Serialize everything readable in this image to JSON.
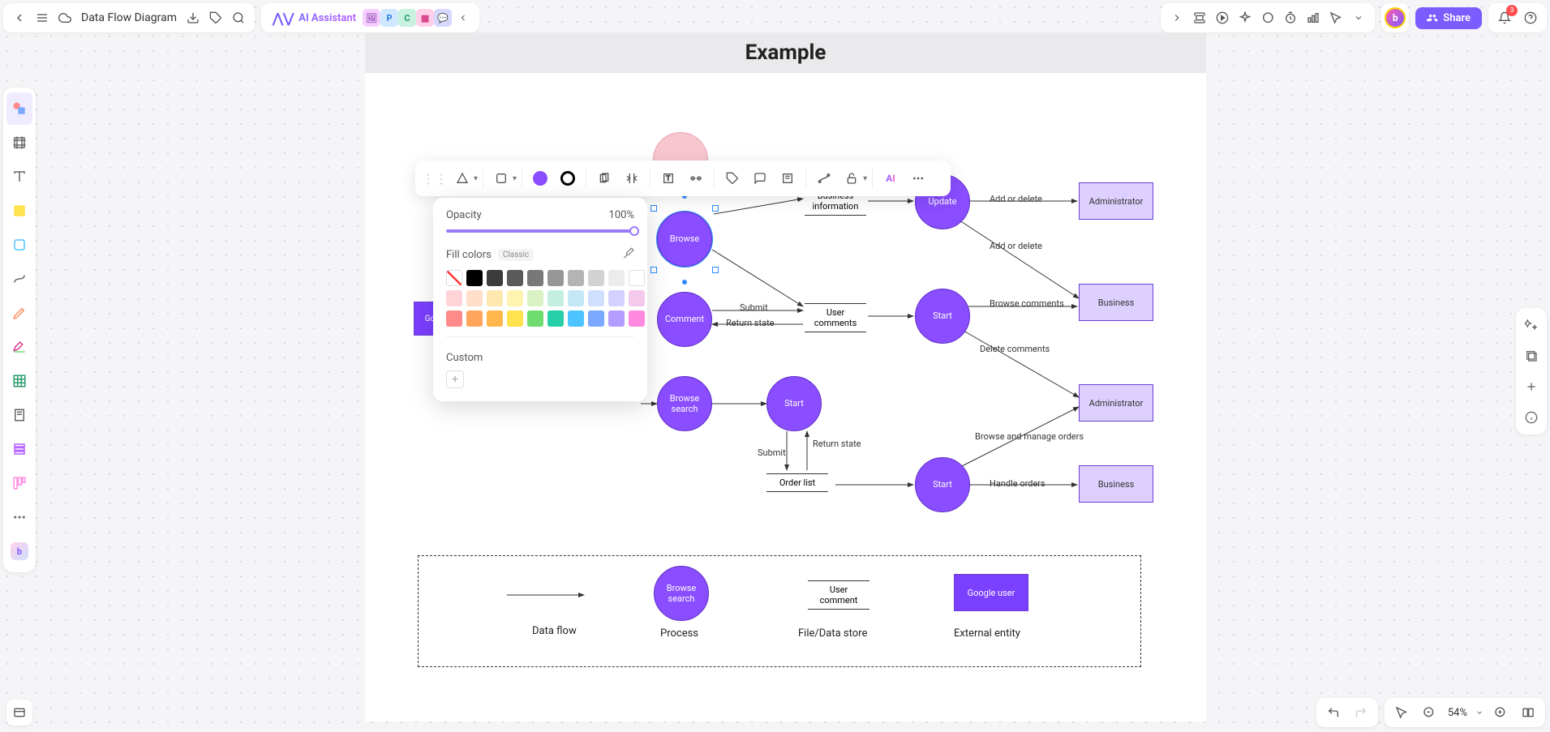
{
  "header": {
    "doc_title": "Data Flow Diagram",
    "ai_label": "AI Assistant",
    "avatar_1": "P",
    "avatar_2": "C",
    "share_label": "Share",
    "notif_count": "3"
  },
  "canvas": {
    "page_title": "Example",
    "zoom_pct": "54%"
  },
  "popover": {
    "opacity_label": "Opacity",
    "opacity_value": "100%",
    "fill_label": "Fill colors",
    "classic_label": "Classic",
    "custom_label": "Custom",
    "colors_row1": [
      "none",
      "#000000",
      "#3c3c3c",
      "#5a5a5a",
      "#787878",
      "#969696",
      "#b4b4b4",
      "#d2d2d2",
      "#ececec",
      "#ffffff"
    ],
    "colors_row2": [
      "#ffd4d8",
      "#ffdfc9",
      "#ffe8b0",
      "#fff3b0",
      "#d9f2c4",
      "#c4efe0",
      "#c4e7f5",
      "#cfe0ff",
      "#d4d0ff",
      "#f5c9ec"
    ],
    "colors_row3": [
      "#ff8a8a",
      "#ffa65c",
      "#ffb74d",
      "#ffe24d",
      "#6edc6e",
      "#26cfa8",
      "#4dc3ff",
      "#7aa9ff",
      "#b39dff",
      "#ff8adf"
    ]
  },
  "diagram": {
    "nodes": {
      "browse_top": "Browse",
      "update": "Update",
      "comment": "Comment",
      "browse_search": "Browse\nsearch",
      "start_mid": "Start",
      "start_search": "Start",
      "start_orders": "Start",
      "go": "Go",
      "admin1": "Administrator",
      "admin2": "Administrator",
      "business1": "Business",
      "business2": "Business"
    },
    "stores": {
      "biz_info": "Business\ninformation",
      "user_comments": "User\ncomments",
      "order_list": "Order list"
    },
    "labels": {
      "add_delete1": "Add or delete",
      "add_delete2": "Add or delete",
      "browse_comments": "Browse comments",
      "delete_comments": "Delete comments",
      "submit1": "Submit",
      "return_state1": "Return state",
      "submit2": "Submit",
      "return_state2": "Return state",
      "browse_manage": "Browse and manage orders",
      "handle_orders": "Handle orders"
    },
    "legend": {
      "dataflow": "Data flow",
      "process": "Process",
      "process_node": "Browse\nsearch",
      "store": "File/Data store",
      "store_node": "User\ncomment",
      "entity": "External entity",
      "entity_node": "Google user"
    }
  },
  "chart_data": {
    "type": "dfd",
    "title": "Example",
    "processes": [
      "Browse",
      "Update",
      "Comment",
      "Start",
      "Start",
      "Start",
      "Browse search"
    ],
    "external_entities": [
      "Administrator",
      "Administrator",
      "Business",
      "Business"
    ],
    "data_stores": [
      "Business information",
      "User comments",
      "Order list"
    ],
    "flows": [
      {
        "from": "Update",
        "to": "Administrator",
        "label": "Add or delete"
      },
      {
        "from": "Update",
        "to": "Business",
        "label": "Add or delete"
      },
      {
        "from": "Comment",
        "to": "User comments",
        "label": "Submit"
      },
      {
        "from": "User comments",
        "to": "Comment",
        "label": "Return state"
      },
      {
        "from": "Start",
        "to": "Business",
        "label": "Browse comments"
      },
      {
        "from": "Start",
        "to": "Administrator",
        "label": "Delete comments"
      },
      {
        "from": "Start",
        "to": "Order list",
        "label": "Submit"
      },
      {
        "from": "Order list",
        "to": "Start",
        "label": "Return state"
      },
      {
        "from": "Start",
        "to": "Business",
        "label": "Handle orders"
      },
      {
        "from": "Start",
        "to": "Administrator",
        "label": "Browse and manage orders"
      }
    ],
    "legend": [
      "Data flow",
      "Process",
      "File/Data store",
      "External entity"
    ]
  }
}
